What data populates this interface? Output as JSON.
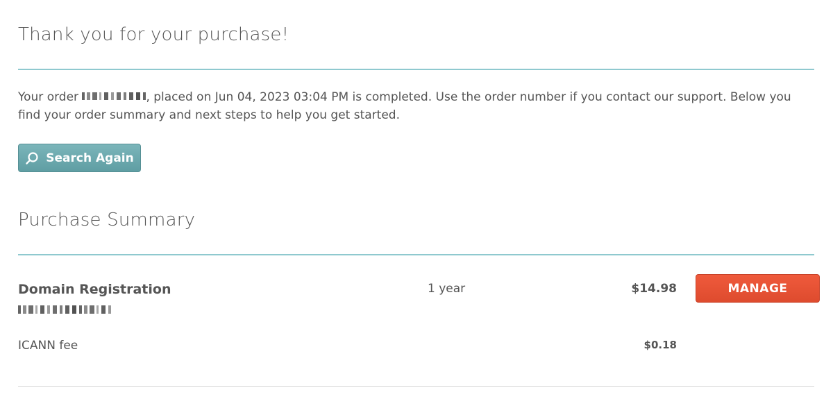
{
  "page": {
    "title": "Thank you for your purchase!"
  },
  "order": {
    "prefix": "Your order",
    "order_number_redacted": true,
    "suffix": ", placed on Jun 04, 2023 03:04 PM is completed. Use the order number if you contact our support. Below you find your order summary and next steps to help you get started."
  },
  "actions": {
    "search_again_label": "Search Again",
    "search_icon": "search-icon"
  },
  "summary": {
    "title": "Purchase Summary",
    "items": [
      {
        "name": "Domain Registration",
        "domain_redacted": true,
        "term": "1 year",
        "price": "$14.98",
        "action_label": "MANAGE"
      }
    ],
    "fees": [
      {
        "name": "ICANN fee",
        "price": "$0.18"
      }
    ]
  },
  "colors": {
    "divider_teal": "#8fc9cf",
    "search_button": "#6aa9ae",
    "manage_button": "#e8513a",
    "text": "#555555"
  }
}
